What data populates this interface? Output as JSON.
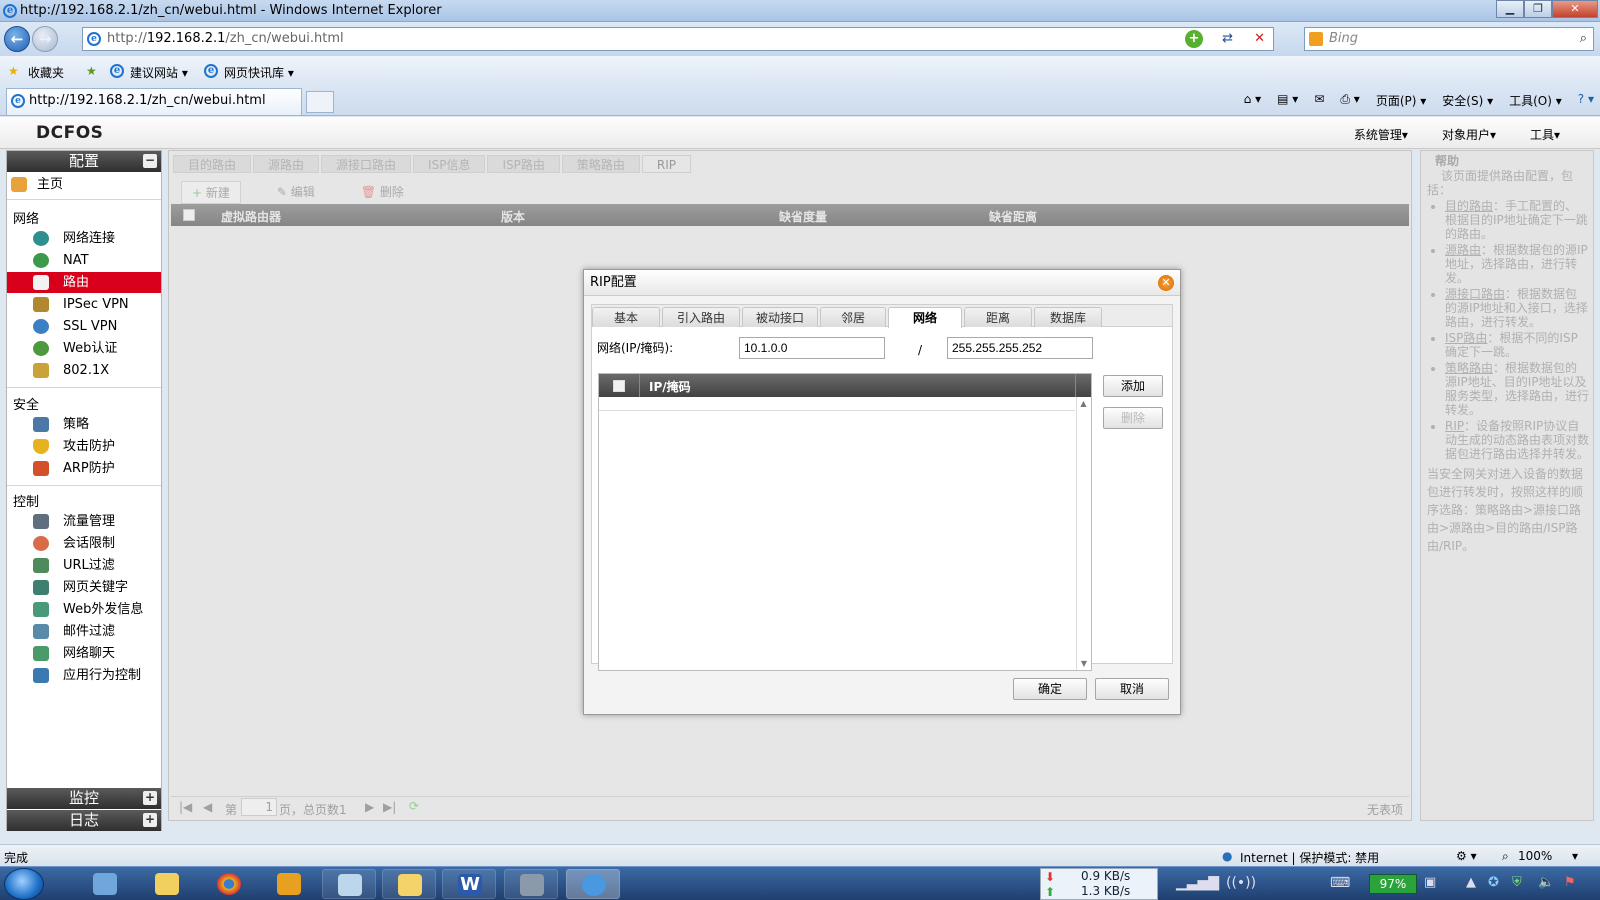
{
  "browser": {
    "title": "http://192.168.2.1/zh_cn/webui.html - Windows Internet Explorer",
    "url_prefix": "http://",
    "url_host": "192.168.2.1",
    "url_path": "/zh_cn/webui.html",
    "search_placeholder": "Bing",
    "favorites": [
      "收藏夹",
      "建议网站 ▾",
      "网页快讯库 ▾"
    ],
    "tab_label": "http://192.168.2.1/zh_cn/webui.html",
    "commands": [
      "页面(P) ▾",
      "安全(S) ▾",
      "工具(O) ▾"
    ]
  },
  "app": {
    "logo": "DCFOS",
    "menu": [
      "系统管理▾",
      "对象用户▾",
      "工具▾"
    ]
  },
  "sidebar": {
    "config_title": "配置",
    "home": "主页",
    "groups": [
      {
        "title": "网络",
        "items": [
          "网络连接",
          "NAT",
          "路由",
          "IPSec VPN",
          "SSL VPN",
          "Web认证",
          "802.1X"
        ]
      },
      {
        "title": "安全",
        "items": [
          "策略",
          "攻击防护",
          "ARP防护"
        ]
      },
      {
        "title": "控制",
        "items": [
          "流量管理",
          "会话限制",
          "URL过滤",
          "网页关键字",
          "Web外发信息",
          "邮件过滤",
          "网络聊天",
          "应用行为控制"
        ]
      }
    ],
    "monitor_title": "监控",
    "log_title": "日志"
  },
  "main": {
    "tabs": [
      "目的路由",
      "源路由",
      "源接口路由",
      "ISP信息",
      "ISP路由",
      "策略路由",
      "RIP"
    ],
    "toolbar": [
      "新建",
      "编辑",
      "删除"
    ],
    "columns": [
      "虚拟路由器",
      "版本",
      "缺省度量",
      "缺省距离"
    ],
    "pager": {
      "page_prefix": "第",
      "page_value": "1",
      "page_suffix": "页，总页数1",
      "empty": "无表项"
    }
  },
  "help": {
    "title": "帮助",
    "intro": "该页面提供路由配置，包括：",
    "items": [
      {
        "name": "目的路由",
        "text": "：手工配置的、根据目的IP地址确定下一跳的路由。"
      },
      {
        "name": "源路由",
        "text": "：根据数据包的源IP地址，选择路由，进行转发。"
      },
      {
        "name": "源接口路由",
        "text": "：根据数据包的源IP地址和入接口，选择路由，进行转发。"
      },
      {
        "name": "ISP路由",
        "text": "：根据不同的ISP确定下一跳。"
      },
      {
        "name": "策略路由",
        "text": "：根据数据包的源IP地址、目的IP地址以及服务类型，选择路由，进行转发。"
      },
      {
        "name": "RIP",
        "text": "：设备按照RIP协议自动生成的动态路由表项对数据包进行路由选择并转发。"
      }
    ],
    "outro": "当安全网关对进入设备的数据包进行转发时，按照这样的顺序选路：策略路由>源接口路由>源路由>目的路由/ISP路由/RIP。"
  },
  "dialog": {
    "title": "RIP配置",
    "tabs": [
      "基本",
      "引入路由",
      "被动接口",
      "邻居",
      "网络",
      "距离",
      "数据库"
    ],
    "active_tab": "网络",
    "field_label": "网络(IP/掩码):",
    "ip_value": "10.1.0.0",
    "slash": "/",
    "mask_value": "255.255.255.252",
    "table_header": "IP/掩码",
    "add_button": "添加",
    "delete_button": "删除",
    "ok_button": "确定",
    "cancel_button": "取消"
  },
  "statusbar": {
    "left": "完成",
    "zone": "Internet | 保护模式: 禁用",
    "zoom": "100%"
  },
  "taskbar": {
    "net_down": "0.9 KB/s",
    "net_up": "1.3 KB/s",
    "battery": "97%"
  }
}
